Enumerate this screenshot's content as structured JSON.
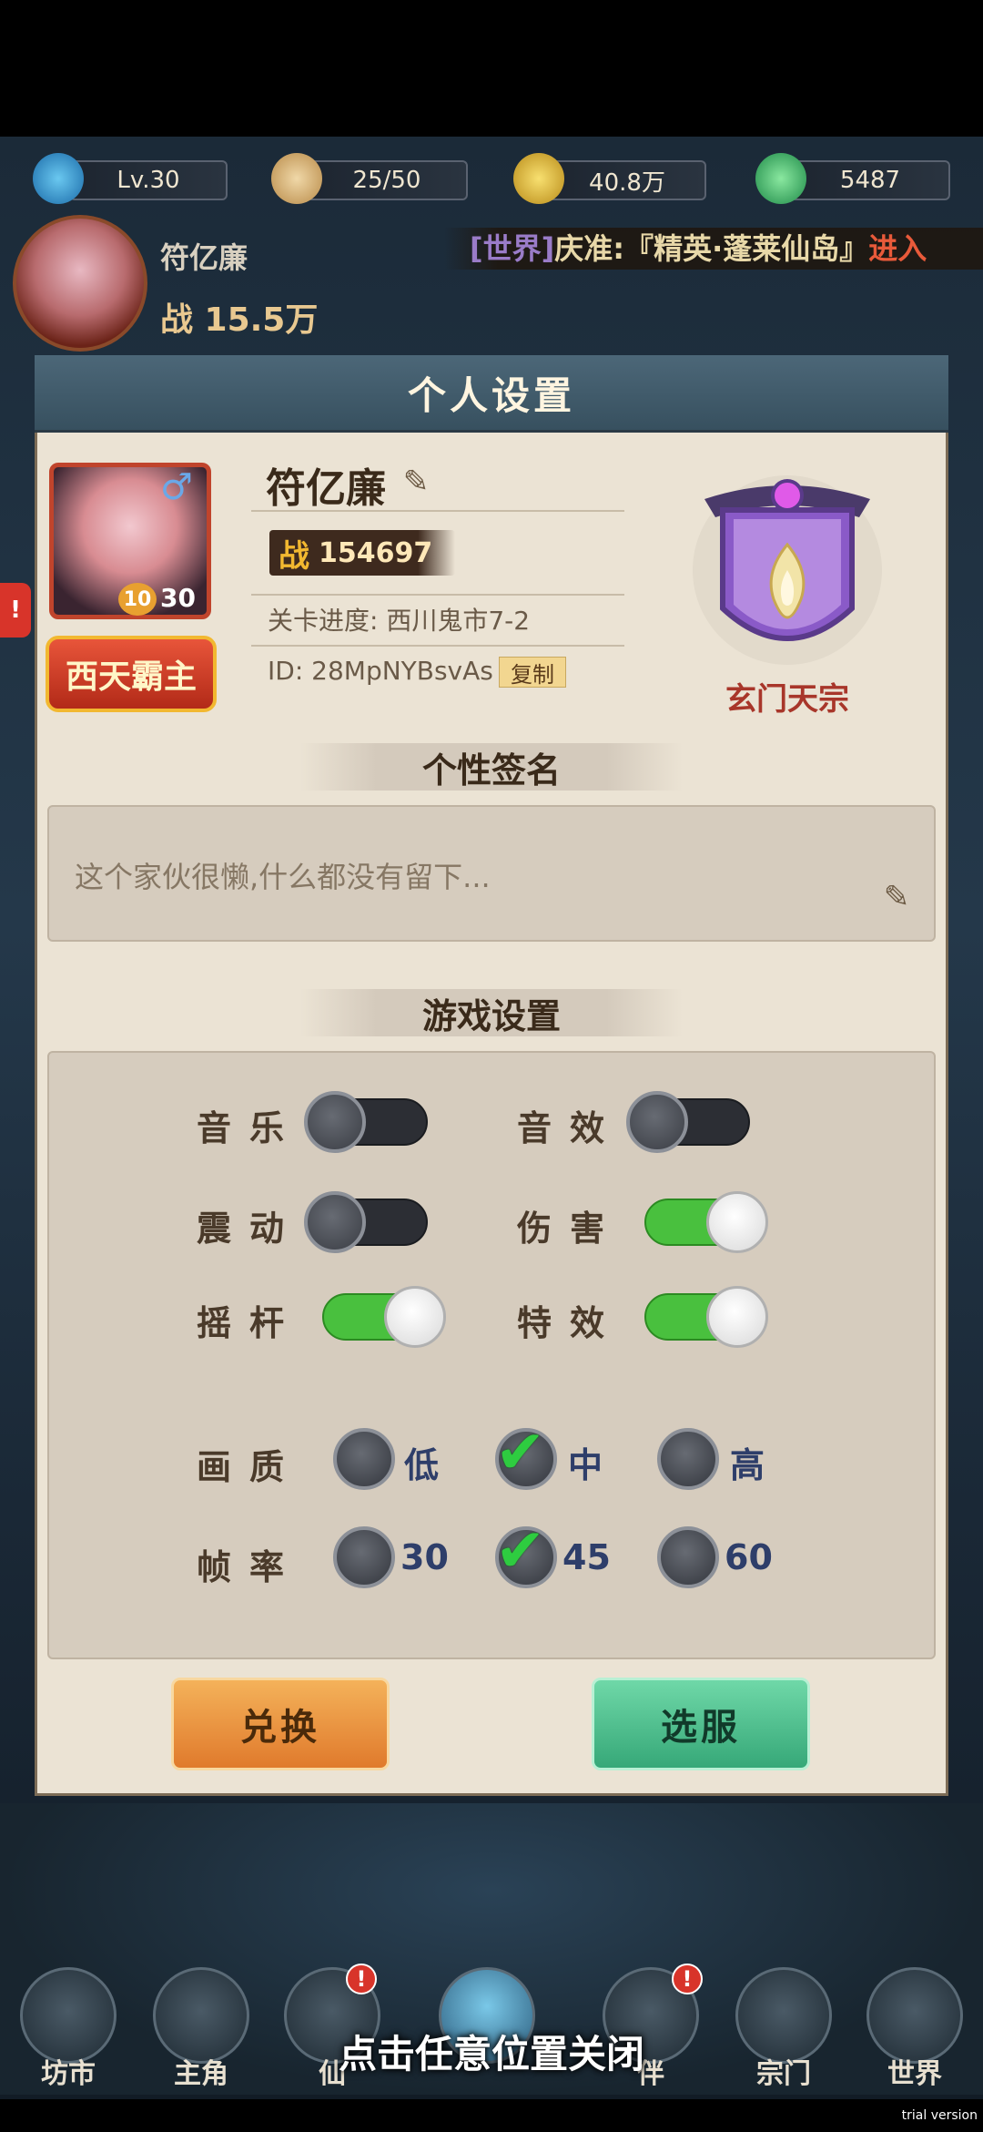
{
  "resources": {
    "level": "Lv.30",
    "stamina": "25/50",
    "coins": "40.8万",
    "jade": "5487"
  },
  "player": {
    "name": "符亿廉",
    "power": "战 15.5万",
    "avatar_level": "10"
  },
  "ticker": {
    "channel": "[世界]",
    "text": "庆准:『精英·蓬莱仙岛』",
    "link": "进入"
  },
  "side_flag": "!",
  "panel": {
    "title": "个人设置",
    "profile": {
      "name": "符亿廉",
      "level_badge": "10",
      "stars": "30",
      "title_badge": "西天霸主",
      "power_label": "战",
      "power_value": "154697",
      "progress": "关卡进度: 西川鬼市7-2",
      "id": "ID: 28MpNYBsvAs",
      "copy_label": "复制"
    },
    "sect": {
      "name": "玄门天宗",
      "emblem_icon": "purple-flame-banner"
    },
    "signature": {
      "header": "个性签名",
      "text": "这个家伙很懒,什么都没有留下..."
    },
    "game_settings": {
      "header": "游戏设置",
      "toggles": [
        {
          "label": "音乐",
          "on": false
        },
        {
          "label": "音效",
          "on": false
        },
        {
          "label": "震动",
          "on": false
        },
        {
          "label": "伤害",
          "on": true
        },
        {
          "label": "摇杆",
          "on": true
        },
        {
          "label": "特效",
          "on": true
        }
      ],
      "quality": {
        "label": "画质",
        "options": [
          "低",
          "中",
          "高"
        ],
        "selected": "中"
      },
      "framerate": {
        "label": "帧率",
        "options": [
          "30",
          "45",
          "60"
        ],
        "selected": "45"
      }
    },
    "buttons": {
      "redeem": "兑换",
      "server": "选服"
    }
  },
  "nav": [
    {
      "label": "坊市",
      "badge": ""
    },
    {
      "label": "主角",
      "badge": ""
    },
    {
      "label": "仙",
      "badge": "!"
    },
    {
      "label": "",
      "badge": ""
    },
    {
      "label": "伴",
      "badge": "!"
    },
    {
      "label": "宗门",
      "badge": ""
    },
    {
      "label": "世界",
      "badge": ""
    }
  ],
  "close_hint": "点击任意位置关闭",
  "watermark": "trial version",
  "colors": {
    "panel_bg": "#ebe3d4",
    "toggle_on": "#49c03e",
    "toggle_off": "#2c2e34",
    "check": "#2ecc40",
    "sect_name": "#a8362a"
  }
}
